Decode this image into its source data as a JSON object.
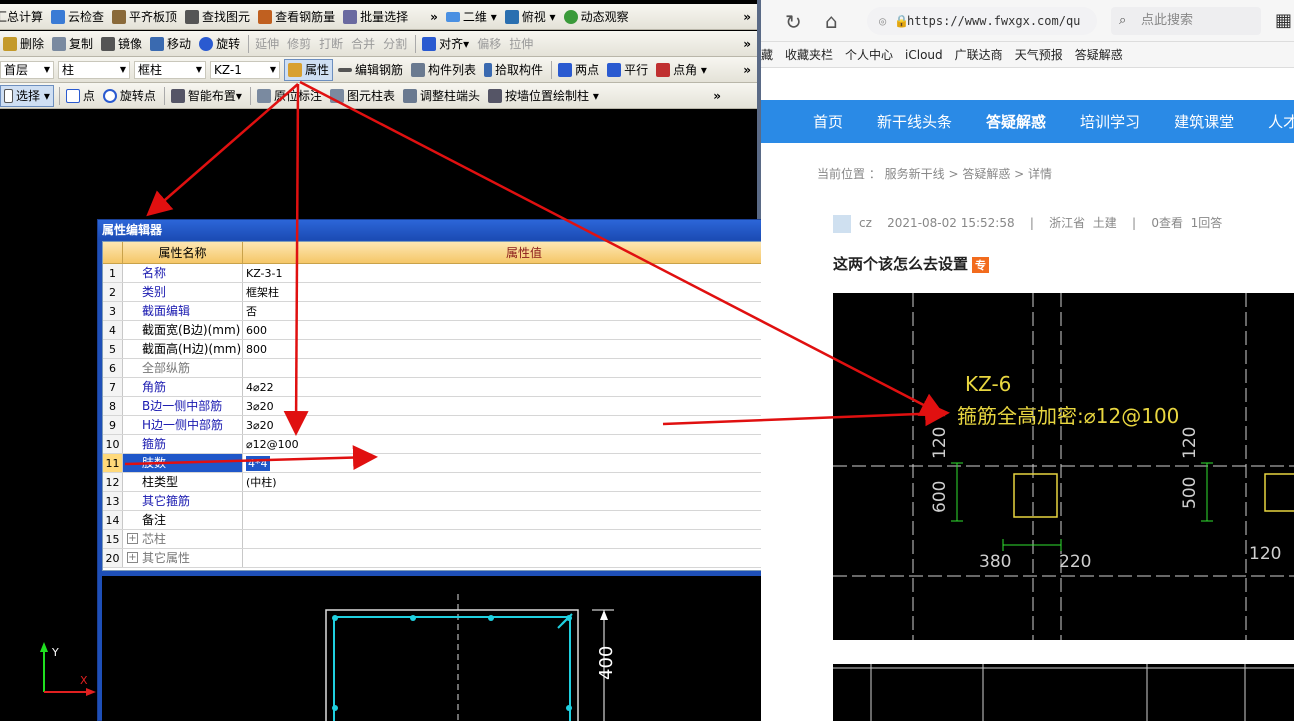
{
  "toolbar1": {
    "items": [
      "汇总计算",
      "云检查",
      "平齐板顶",
      "查找图元",
      "查看钢筋量",
      "批量选择"
    ],
    "view_mode": "二维",
    "view_angle": "俯视",
    "dynamic": "动态观察",
    "more": "»"
  },
  "toolbar2": {
    "items": [
      "删除",
      "复制",
      "镜像",
      "移动",
      "旋转"
    ],
    "disabled": [
      "延伸",
      "修剪",
      "打断",
      "合并",
      "分割"
    ],
    "align": "对齐",
    "disabled2": [
      "偏移",
      "拉伸"
    ],
    "more": "»"
  },
  "toolbar3": {
    "floor": "首层",
    "category": "柱",
    "type": "框柱",
    "component": "KZ-1",
    "properties": "属性",
    "edit_rebar": "编辑钢筋",
    "component_list": "构件列表",
    "pick": "拾取构件",
    "two_point": "两点",
    "parallel": "平行",
    "point_angle": "点角",
    "more": "»"
  },
  "toolbar4": {
    "select": "选择",
    "point": "点",
    "rotate_point": "旋转点",
    "smart": "智能布置",
    "origin_mark": "原位标注",
    "col_table": "图元柱表",
    "adjust_end": "调整柱端头",
    "wall_draw": "按墙位置绘制柱",
    "more": "»"
  },
  "editor": {
    "title": "属性编辑器",
    "close": "✕",
    "col_name": "属性名称",
    "col_value": "属性值",
    "rows": [
      {
        "n": "1",
        "name": "名称",
        "value": "KZ-3-1"
      },
      {
        "n": "2",
        "name": "类别",
        "value": "框架柱"
      },
      {
        "n": "3",
        "name": "截面编辑",
        "value": "否"
      },
      {
        "n": "4",
        "name": "截面宽(B边)(mm)",
        "value": "600"
      },
      {
        "n": "5",
        "name": "截面高(H边)(mm)",
        "value": "800"
      },
      {
        "n": "6",
        "name": "全部纵筋",
        "value": ""
      },
      {
        "n": "7",
        "name": "角筋",
        "value": "4⌀22"
      },
      {
        "n": "8",
        "name": "B边一侧中部筋",
        "value": "3⌀20"
      },
      {
        "n": "9",
        "name": "H边一侧中部筋",
        "value": "3⌀20"
      },
      {
        "n": "10",
        "name": "箍筋",
        "value": "⌀12@100"
      },
      {
        "n": "11",
        "name": "肢数",
        "value": "4*4"
      },
      {
        "n": "12",
        "name": "柱类型",
        "value": "(中柱)"
      },
      {
        "n": "13",
        "name": "其它箍筋",
        "value": ""
      },
      {
        "n": "14",
        "name": "备注",
        "value": ""
      },
      {
        "n": "15",
        "name": "芯柱",
        "value": ""
      },
      {
        "n": "20",
        "name": "其它属性",
        "value": ""
      }
    ],
    "preview_dim": "400"
  },
  "axis": {
    "x": "X",
    "y": "Y"
  },
  "browser": {
    "url": "https://www.fwxgx.com/qu",
    "search_placeholder": "点此搜索",
    "bookmarks": [
      "藏",
      "收藏夹栏",
      "个人中心",
      "iCloud",
      "广联达商",
      "天气预报",
      "答疑解惑"
    ],
    "menu": [
      "首页",
      "新干线头条",
      "答疑解惑",
      "培训学习",
      "建筑课堂",
      "人才"
    ],
    "breadcrumb": "当前位置 ： 服务新干线 > 答疑解惑 > 详情",
    "meta": "cz    2021-08-02 15:52:58    |    浙江省  土建    |    0查看  1回答",
    "question": "这两个该怎么去设置",
    "tag": "专"
  },
  "drawing": {
    "label": "KZ-6",
    "note": "箍筋全高加密:⌀12@100",
    "dims": [
      "120",
      "600",
      "380",
      "220",
      "120",
      "500",
      "120"
    ]
  },
  "colors": {
    "arrow": "#e01010",
    "cad_bg": "#000000",
    "menu_blue": "#2a8ae6",
    "cyan": "#20d0e0",
    "yellow": "#e8d640",
    "green": "#30e030"
  }
}
